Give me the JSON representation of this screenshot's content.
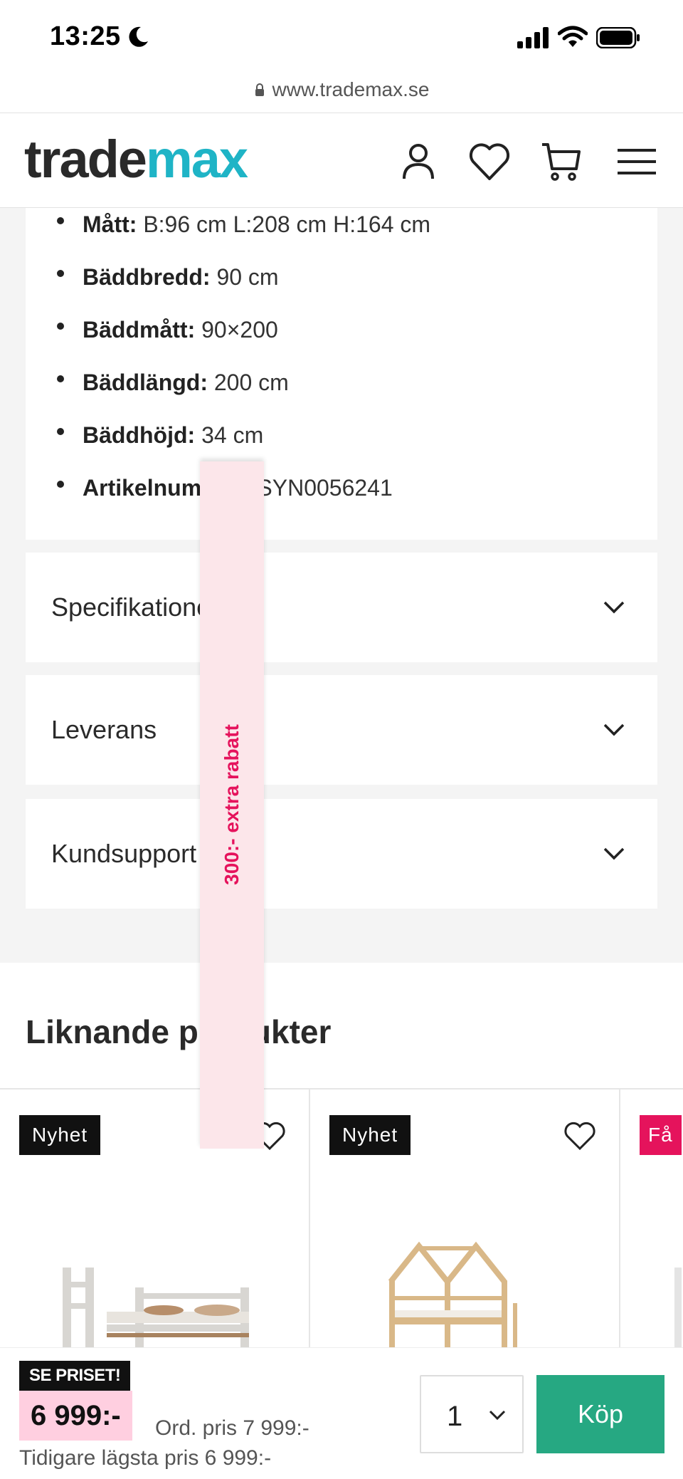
{
  "status": {
    "time": "13:25"
  },
  "browser": {
    "url": "www.trademax.se"
  },
  "header": {
    "logo_part1": "trade",
    "logo_part2": "max"
  },
  "specs": [
    {
      "key": "Mått:",
      "value": " B:96 cm L:208 cm H:164 cm"
    },
    {
      "key": "Bäddbredd:",
      "value": " 90 cm"
    },
    {
      "key": "Bäddmått:",
      "value": " 90×200"
    },
    {
      "key": "Bäddlängd:",
      "value": " 200 cm"
    },
    {
      "key": "Bäddhöjd:",
      "value": " 34 cm"
    },
    {
      "key": "Artikelnummer:",
      "value": " SYN0056241"
    }
  ],
  "accordions": [
    {
      "label": "Specifikationer"
    },
    {
      "label": "Leverans"
    },
    {
      "label": "Kundsupport"
    }
  ],
  "similar": {
    "title": "Liknande produkter",
    "products": [
      {
        "badge": "Nyhet"
      },
      {
        "badge": "Nyhet"
      },
      {
        "badge": "Få"
      }
    ]
  },
  "promo": {
    "label": "300:- extra rabatt"
  },
  "purchase": {
    "tag": "SE PRISET!",
    "price": "6 999:-",
    "ord_price": "Ord. pris 7 999:-",
    "lowest_price": "Tidigare lägsta pris 6 999:-",
    "quantity": "1",
    "buy_label": "Köp"
  },
  "colors": {
    "brand_dark": "#2a2a2a",
    "brand_accent": "#1fb4c6",
    "buy": "#26a882",
    "promo": "#e5135c",
    "price_bg": "#ffcfe0"
  }
}
